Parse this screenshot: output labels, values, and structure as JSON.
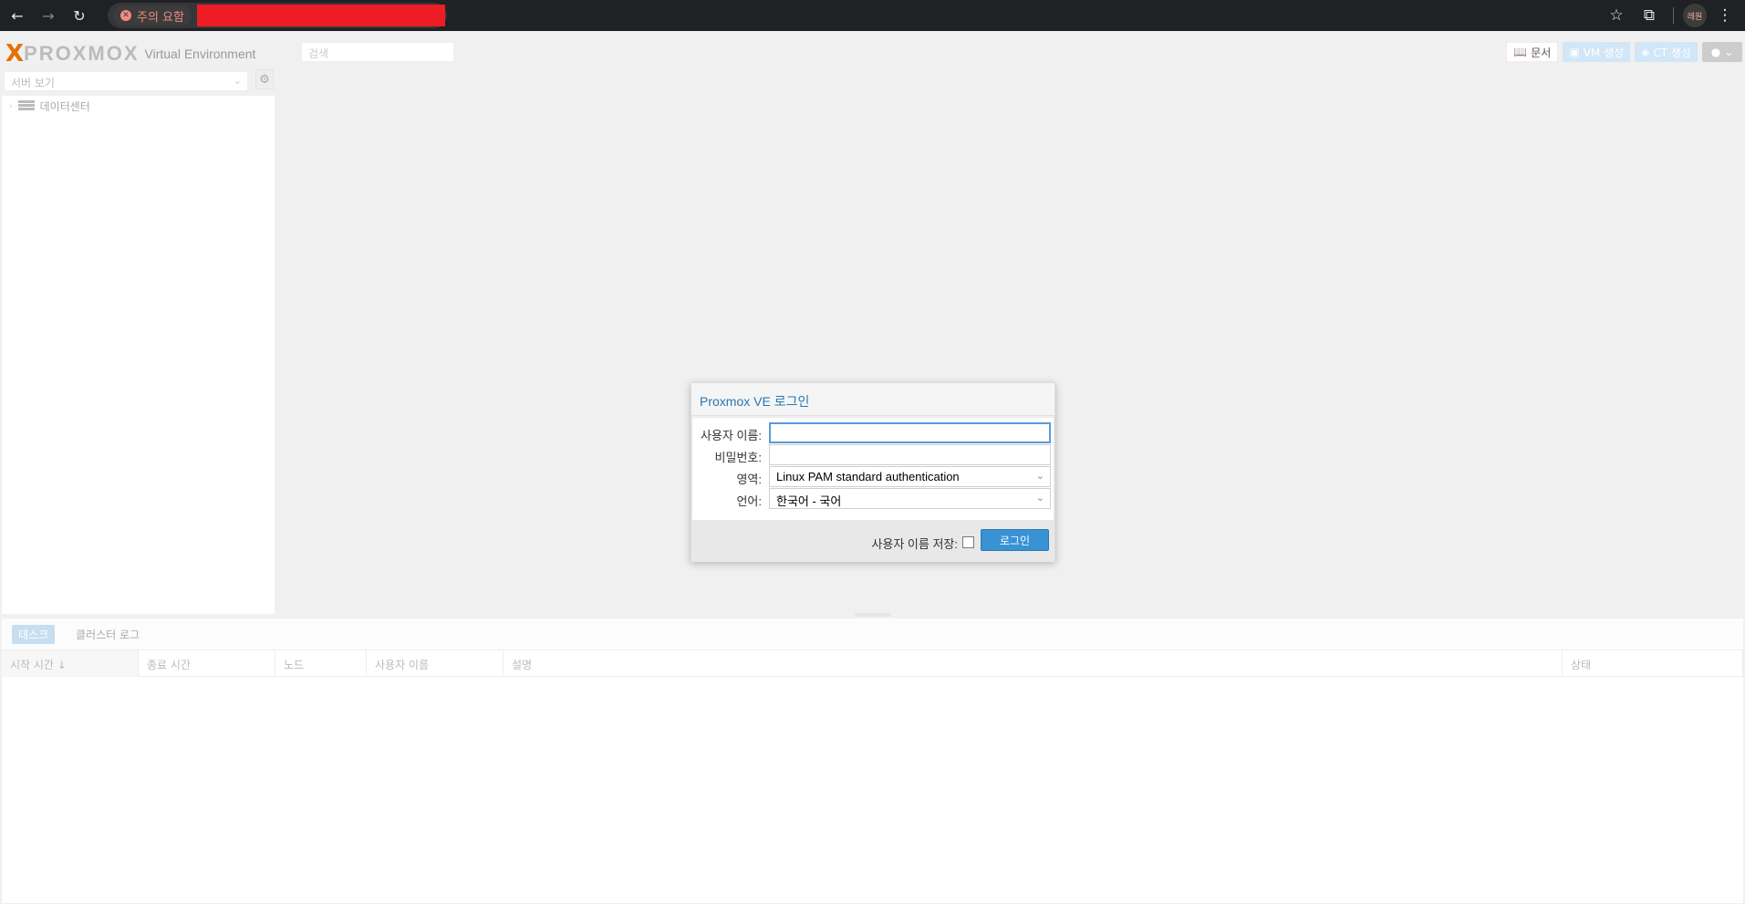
{
  "browser": {
    "security_label": "주의 요함",
    "profile_label": "레원"
  },
  "header": {
    "logo_text": "PROXMOX",
    "product": "Virtual Environment",
    "search_placeholder": "검색",
    "docs_label": "문서",
    "create_vm_label": "VM 생성",
    "create_ct_label": "CT 생성"
  },
  "sidebar": {
    "view_select": "서버 보기",
    "tree_root": "데이터센터"
  },
  "log_panel": {
    "tabs": [
      "태스크",
      "클러스터 로그"
    ],
    "columns": [
      "시작 시간 ↓",
      "종료 시간",
      "노드",
      "사용자 이름",
      "설명",
      "상태"
    ]
  },
  "login": {
    "title": "Proxmox VE 로그인",
    "username_label": "사용자 이름:",
    "username_value": "",
    "password_label": "비밀번호:",
    "password_value": "",
    "realm_label": "영역:",
    "realm_value": "Linux PAM standard authentication",
    "language_label": "언어:",
    "language_value": "한국어 - 국어",
    "save_username_label": "사용자 이름 저장:",
    "save_username_checked": false,
    "login_button": "로그인"
  },
  "colors": {
    "accent": "#3892d4",
    "title_blue": "#2577b3",
    "logo_orange": "#e57000",
    "browser_dark": "#202124",
    "warning_red": "#f28b82"
  }
}
